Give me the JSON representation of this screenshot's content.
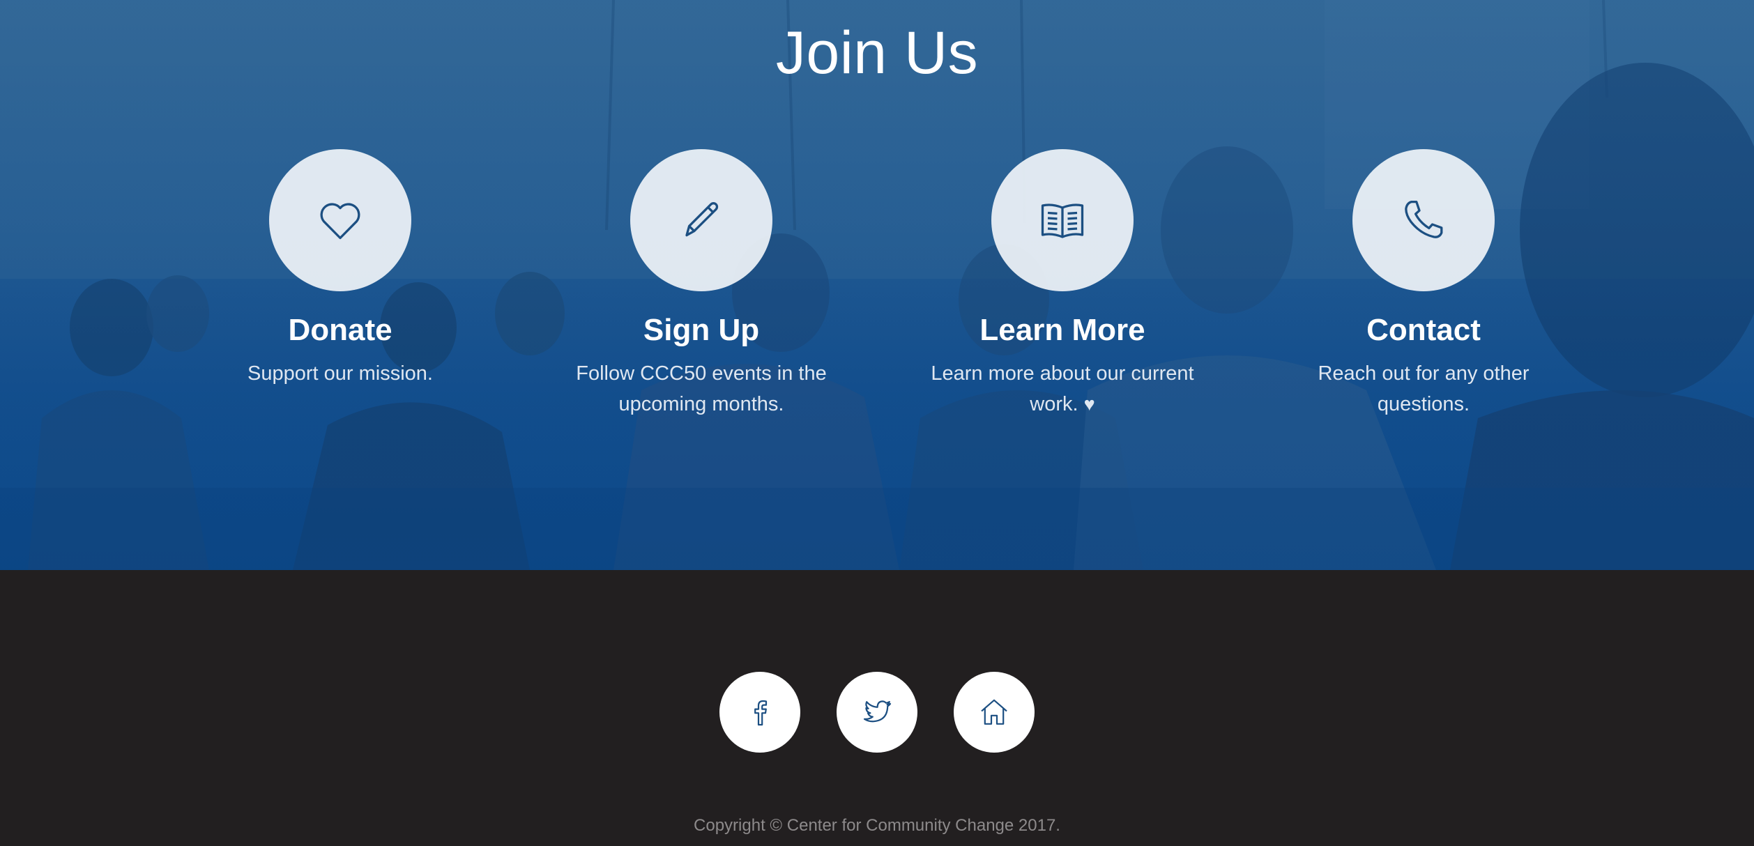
{
  "join": {
    "title": "Join Us",
    "cards": [
      {
        "title": "Donate",
        "description": "Support our mission.",
        "icon": "heart-icon"
      },
      {
        "title": "Sign Up",
        "description": "Follow CCC50 events in the upcoming months.",
        "icon": "pencil-icon"
      },
      {
        "title": "Learn More",
        "description": "Learn more about our current work.",
        "heart": "♥",
        "icon": "book-icon"
      },
      {
        "title": "Contact",
        "description": "Reach out for any other questions.",
        "icon": "phone-icon"
      }
    ]
  },
  "footer": {
    "social": [
      {
        "icon": "facebook-icon"
      },
      {
        "icon": "twitter-icon"
      },
      {
        "icon": "home-icon"
      }
    ],
    "copyright": "Copyright © Center for Community Change 2017."
  },
  "colors": {
    "brand_blue": "#0d4a88",
    "icon_blue": "#1c4f82",
    "footer_bg": "#221f20"
  }
}
